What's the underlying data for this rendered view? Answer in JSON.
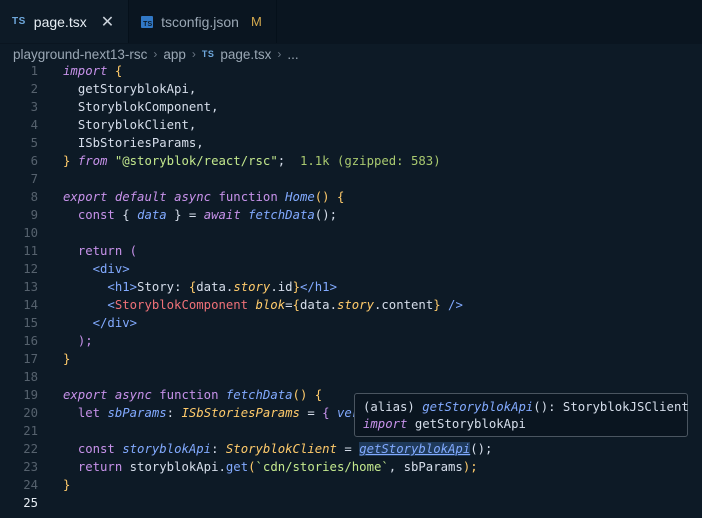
{
  "tabs": [
    {
      "badge": "TS",
      "label": "page.tsx",
      "active": true
    },
    {
      "label": "tsconfig.json",
      "status": "M"
    }
  ],
  "breadcrumb": {
    "root": "playground-next13-rsc",
    "folder": "app",
    "badge": "TS",
    "file": "page.tsx",
    "more": "..."
  },
  "lines": [
    {
      "n": "1"
    },
    {
      "n": "2"
    },
    {
      "n": "3"
    },
    {
      "n": "4"
    },
    {
      "n": "5"
    },
    {
      "n": "6"
    },
    {
      "n": "7"
    },
    {
      "n": "8"
    },
    {
      "n": "9"
    },
    {
      "n": "10"
    },
    {
      "n": "11"
    },
    {
      "n": "12"
    },
    {
      "n": "13"
    },
    {
      "n": "14"
    },
    {
      "n": "15"
    },
    {
      "n": "16"
    },
    {
      "n": "17"
    },
    {
      "n": "18"
    },
    {
      "n": "19"
    },
    {
      "n": "20"
    },
    {
      "n": "21"
    },
    {
      "n": "22"
    },
    {
      "n": "23"
    },
    {
      "n": "24"
    },
    {
      "n": "25"
    }
  ],
  "code": {
    "l1_import": "import",
    "l1_brace": "{",
    "l2": "getStoryblokApi,",
    "l3": "StoryblokComponent,",
    "l4": "StoryblokClient,",
    "l5": "ISbStoriesParams,",
    "l6_brace": "}",
    "l6_from": "from",
    "l6_str": "\"@storyblok/react/rsc\"",
    "l6_semi": ";",
    "l6_hint": "1.1k (gzipped: 583)",
    "l8_export": "export",
    "l8_default": "default",
    "l8_async": "async",
    "l8_function": "function",
    "l8_name": "Home",
    "l8_parens": "()",
    "l8_brace": "{",
    "l9_const": "const",
    "l9_open": "{",
    "l9_data": "data",
    "l9_close": "}",
    "l9_eq": "=",
    "l9_await": "await",
    "l9_fn": "fetchData",
    "l9_parens": "();",
    "l11_return": "return",
    "l11_paren": "(",
    "l12_tag": "<div>",
    "l13_open": "<h1>",
    "l13_text": "Story: ",
    "l13_lb": "{",
    "l13_data": "data",
    "l13_dot1": ".",
    "l13_story": "story",
    "l13_dot2": ".",
    "l13_id": "id",
    "l13_rb": "}",
    "l13_close": "</h1>",
    "l14_lt": "<",
    "l14_comp": "StoryblokComponent",
    "l14_attr": "blok",
    "l14_eq": "=",
    "l14_lb": "{",
    "l14_data": "data",
    "l14_dot1": ".",
    "l14_story": "story",
    "l14_dot2": ".",
    "l14_content": "content",
    "l14_rb": "}",
    "l14_end": " />",
    "l15_tag": "</div>",
    "l16": ");",
    "l17": "}",
    "l19_export": "export",
    "l19_async": "async",
    "l19_function": "function",
    "l19_name": "fetchData",
    "l19_parens": "()",
    "l19_brace": "{",
    "l20_let": "let",
    "l20_var": "sbParams",
    "l20_colon": ":",
    "l20_type": "ISbStoriesParams",
    "l20_eq": "=",
    "l20_brace": "{",
    "l20_ver": "ver",
    "l22_const": "const",
    "l22_var": "storyblokApi",
    "l22_colon": ":",
    "l22_type": "StoryblokClient",
    "l22_eq": "=",
    "l22_fn": "getStoryblokApi",
    "l22_end": "();",
    "l23_return": "return",
    "l23_obj": "storyblokApi",
    "l23_dot": ".",
    "l23_get": "get",
    "l23_paren": "(",
    "l23_str": "`cdn/stories/home`",
    "l23_rest": ", sbParams",
    "l23_end": ");",
    "l24": "}"
  },
  "hover": {
    "line1_prefix": "(alias) ",
    "line1_fn": "getStoryblokApi",
    "line1_rest": "(): StoryblokJSClient",
    "line2_kw": "import",
    "line2_rest": " getStoryblokApi"
  }
}
